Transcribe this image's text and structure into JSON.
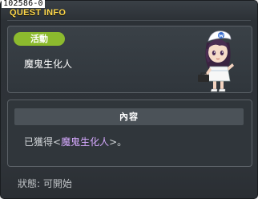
{
  "quest": {
    "id": "102586-0",
    "title": "QUEST INFO",
    "category": "活動",
    "name": "魔鬼生化人"
  },
  "content": {
    "header": "內容",
    "text_prefix": "已獲得<",
    "item": "魔鬼生化人",
    "text_suffix": ">。"
  },
  "status": {
    "label": "狀態:",
    "value": "可開始"
  },
  "colors": {
    "title": "#ffd84a",
    "badge": "#8cba2e",
    "highlight": "#d6a9ff"
  },
  "icons": {
    "npc": "nurse-npc-portrait"
  }
}
